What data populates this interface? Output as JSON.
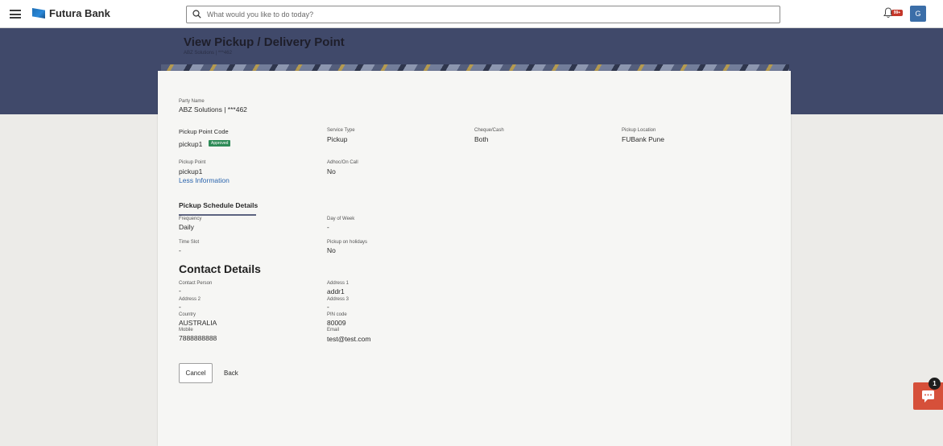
{
  "header": {
    "brand": "Futura Bank",
    "search_placeholder": "What would you like to do today?",
    "notification_badge": "99+",
    "user_initial": "G"
  },
  "page": {
    "title": "View Pickup / Delivery Point",
    "subtitle": "ABZ Solutions | ***462"
  },
  "party": {
    "label": "Party Name",
    "value": "ABZ Solutions | ***462"
  },
  "details": {
    "pickup_point_code_label": "Pickup Point Code",
    "pickup_point_code": "pickup1",
    "status": "Approved",
    "service_type_label": "Service Type",
    "service_type": "Pickup",
    "cheque_cash_label": "Cheque/Cash",
    "cheque_cash": "Both",
    "pickup_location_label": "Pickup Location",
    "pickup_location": "FUBank Pune",
    "pickup_point_label": "Pickup Point",
    "pickup_point": "pickup1",
    "adhoc_label": "Adhoc/On Call",
    "adhoc": "No",
    "less_info": "Less Information"
  },
  "schedule": {
    "title": "Pickup Schedule Details",
    "frequency_label": "Frequency",
    "frequency": "Daily",
    "day_of_week_label": "Day of Week",
    "day_of_week": "-",
    "time_slot_label": "Time Slot",
    "time_slot": "-",
    "holidays_label": "Pickup on holidays",
    "holidays": "No"
  },
  "contact": {
    "title": "Contact Details",
    "person_label": "Contact Person",
    "person": "-",
    "address1_label": "Address 1",
    "address1": "addr1",
    "address2_label": "Address 2",
    "address2": "-",
    "address3_label": "Address 3",
    "address3": "-",
    "country_label": "Country",
    "country": "AUSTRALIA",
    "pin_label": "PIN code",
    "pin": "80009",
    "mobile_label": "Mobile",
    "mobile": "7888888888",
    "email_label": "Email",
    "email": "test@test.com"
  },
  "actions": {
    "cancel": "Cancel",
    "back": "Back"
  },
  "chat": {
    "badge": "1"
  },
  "colors": {
    "banner": "#40496a",
    "approved": "#2e8b57",
    "link": "#2a64ad",
    "chat": "#d6503a"
  }
}
